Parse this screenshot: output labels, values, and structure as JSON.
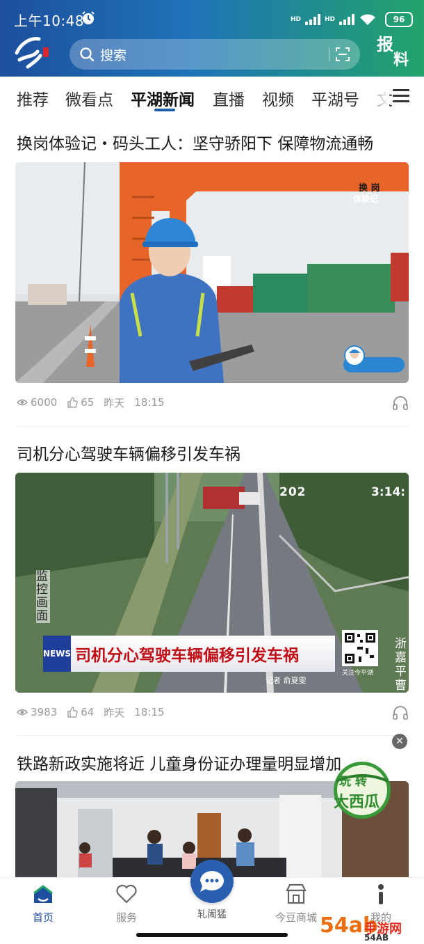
{
  "status": {
    "time": "上午10:48",
    "net1": "HD",
    "net2": "HD",
    "battery": "96"
  },
  "header": {
    "search_placeholder": "搜索",
    "report_char1": "报",
    "report_char2": "料"
  },
  "tabs": [
    "推荐",
    "微看点",
    "平湖新闻",
    "直播",
    "视频",
    "平湖号",
    "文"
  ],
  "active_tab": "平湖新闻",
  "articles": [
    {
      "title": "换岗体验记・码头工人：坚守骄阳下 保障物流通畅",
      "badge_top": "换 岗",
      "badge_bottom": "体验记",
      "views": "6000",
      "likes": "65",
      "date": "昨天",
      "time": "18:15"
    },
    {
      "title": "司机分心驾驶车辆偏移引发车祸",
      "cctv_label": "监控画面",
      "timestamp_left": "202",
      "timestamp_right": "3:14:",
      "news_tag": "NEWS",
      "caption": "司机分心驾驶车辆偏移引发车祸",
      "reporter": "记者  俞夏雯",
      "follow": "关注今平湖",
      "side_text": "浙嘉平曹",
      "views": "3983",
      "likes": "64",
      "date": "昨天",
      "time": "18:15"
    },
    {
      "title": "铁路新政实施将近 儿童身份证办理量明显增加"
    }
  ],
  "ad_badge": {
    "line1": "玩 转",
    "line2": "大西瓜"
  },
  "bottom_nav": {
    "home": "首页",
    "service": "服务",
    "center": "轧闹猛",
    "mall": "今豆商城",
    "mine": "我的"
  },
  "watermark": {
    "main": "54ab",
    "sub": "手游网",
    "site": "54AB"
  },
  "colors": {
    "header_start": "#1d4f9e",
    "header_end": "#22a36a",
    "accent": "#1f5fa8",
    "caption_red": "#c00f17"
  },
  "icons": [
    "alarm-icon",
    "search-icon",
    "scan-icon",
    "eye-icon",
    "thumb-up-icon",
    "headphone-icon",
    "home-icon",
    "heart-icon",
    "chat-icon",
    "store-icon",
    "person-icon",
    "menu-icon",
    "close-icon"
  ]
}
